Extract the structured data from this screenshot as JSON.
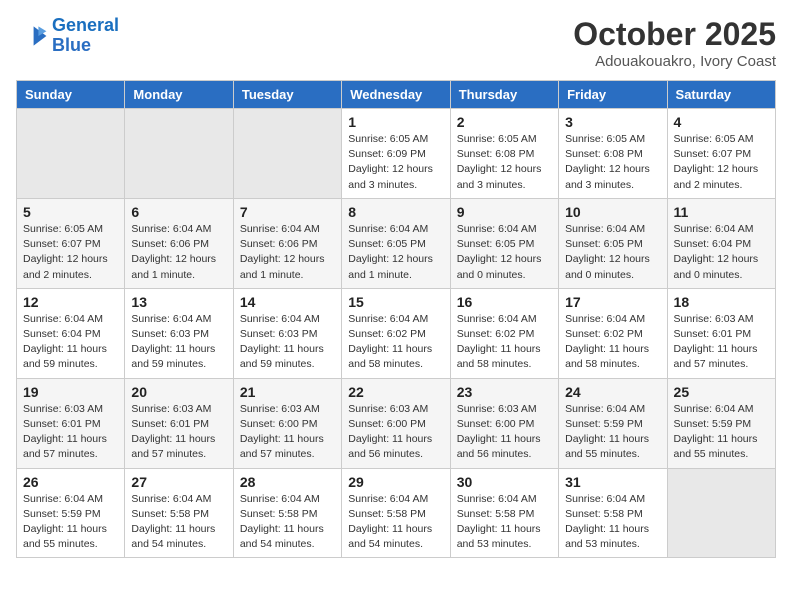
{
  "header": {
    "logo_line1": "General",
    "logo_line2": "Blue",
    "month": "October 2025",
    "location": "Adouakouakro, Ivory Coast"
  },
  "weekdays": [
    "Sunday",
    "Monday",
    "Tuesday",
    "Wednesday",
    "Thursday",
    "Friday",
    "Saturday"
  ],
  "weeks": [
    [
      {
        "day": "",
        "info": ""
      },
      {
        "day": "",
        "info": ""
      },
      {
        "day": "",
        "info": ""
      },
      {
        "day": "1",
        "info": "Sunrise: 6:05 AM\nSunset: 6:09 PM\nDaylight: 12 hours\nand 3 minutes."
      },
      {
        "day": "2",
        "info": "Sunrise: 6:05 AM\nSunset: 6:08 PM\nDaylight: 12 hours\nand 3 minutes."
      },
      {
        "day": "3",
        "info": "Sunrise: 6:05 AM\nSunset: 6:08 PM\nDaylight: 12 hours\nand 3 minutes."
      },
      {
        "day": "4",
        "info": "Sunrise: 6:05 AM\nSunset: 6:07 PM\nDaylight: 12 hours\nand 2 minutes."
      }
    ],
    [
      {
        "day": "5",
        "info": "Sunrise: 6:05 AM\nSunset: 6:07 PM\nDaylight: 12 hours\nand 2 minutes."
      },
      {
        "day": "6",
        "info": "Sunrise: 6:04 AM\nSunset: 6:06 PM\nDaylight: 12 hours\nand 1 minute."
      },
      {
        "day": "7",
        "info": "Sunrise: 6:04 AM\nSunset: 6:06 PM\nDaylight: 12 hours\nand 1 minute."
      },
      {
        "day": "8",
        "info": "Sunrise: 6:04 AM\nSunset: 6:05 PM\nDaylight: 12 hours\nand 1 minute."
      },
      {
        "day": "9",
        "info": "Sunrise: 6:04 AM\nSunset: 6:05 PM\nDaylight: 12 hours\nand 0 minutes."
      },
      {
        "day": "10",
        "info": "Sunrise: 6:04 AM\nSunset: 6:05 PM\nDaylight: 12 hours\nand 0 minutes."
      },
      {
        "day": "11",
        "info": "Sunrise: 6:04 AM\nSunset: 6:04 PM\nDaylight: 12 hours\nand 0 minutes."
      }
    ],
    [
      {
        "day": "12",
        "info": "Sunrise: 6:04 AM\nSunset: 6:04 PM\nDaylight: 11 hours\nand 59 minutes."
      },
      {
        "day": "13",
        "info": "Sunrise: 6:04 AM\nSunset: 6:03 PM\nDaylight: 11 hours\nand 59 minutes."
      },
      {
        "day": "14",
        "info": "Sunrise: 6:04 AM\nSunset: 6:03 PM\nDaylight: 11 hours\nand 59 minutes."
      },
      {
        "day": "15",
        "info": "Sunrise: 6:04 AM\nSunset: 6:02 PM\nDaylight: 11 hours\nand 58 minutes."
      },
      {
        "day": "16",
        "info": "Sunrise: 6:04 AM\nSunset: 6:02 PM\nDaylight: 11 hours\nand 58 minutes."
      },
      {
        "day": "17",
        "info": "Sunrise: 6:04 AM\nSunset: 6:02 PM\nDaylight: 11 hours\nand 58 minutes."
      },
      {
        "day": "18",
        "info": "Sunrise: 6:03 AM\nSunset: 6:01 PM\nDaylight: 11 hours\nand 57 minutes."
      }
    ],
    [
      {
        "day": "19",
        "info": "Sunrise: 6:03 AM\nSunset: 6:01 PM\nDaylight: 11 hours\nand 57 minutes."
      },
      {
        "day": "20",
        "info": "Sunrise: 6:03 AM\nSunset: 6:01 PM\nDaylight: 11 hours\nand 57 minutes."
      },
      {
        "day": "21",
        "info": "Sunrise: 6:03 AM\nSunset: 6:00 PM\nDaylight: 11 hours\nand 57 minutes."
      },
      {
        "day": "22",
        "info": "Sunrise: 6:03 AM\nSunset: 6:00 PM\nDaylight: 11 hours\nand 56 minutes."
      },
      {
        "day": "23",
        "info": "Sunrise: 6:03 AM\nSunset: 6:00 PM\nDaylight: 11 hours\nand 56 minutes."
      },
      {
        "day": "24",
        "info": "Sunrise: 6:04 AM\nSunset: 5:59 PM\nDaylight: 11 hours\nand 55 minutes."
      },
      {
        "day": "25",
        "info": "Sunrise: 6:04 AM\nSunset: 5:59 PM\nDaylight: 11 hours\nand 55 minutes."
      }
    ],
    [
      {
        "day": "26",
        "info": "Sunrise: 6:04 AM\nSunset: 5:59 PM\nDaylight: 11 hours\nand 55 minutes."
      },
      {
        "day": "27",
        "info": "Sunrise: 6:04 AM\nSunset: 5:58 PM\nDaylight: 11 hours\nand 54 minutes."
      },
      {
        "day": "28",
        "info": "Sunrise: 6:04 AM\nSunset: 5:58 PM\nDaylight: 11 hours\nand 54 minutes."
      },
      {
        "day": "29",
        "info": "Sunrise: 6:04 AM\nSunset: 5:58 PM\nDaylight: 11 hours\nand 54 minutes."
      },
      {
        "day": "30",
        "info": "Sunrise: 6:04 AM\nSunset: 5:58 PM\nDaylight: 11 hours\nand 53 minutes."
      },
      {
        "day": "31",
        "info": "Sunrise: 6:04 AM\nSunset: 5:58 PM\nDaylight: 11 hours\nand 53 minutes."
      },
      {
        "day": "",
        "info": ""
      }
    ]
  ]
}
